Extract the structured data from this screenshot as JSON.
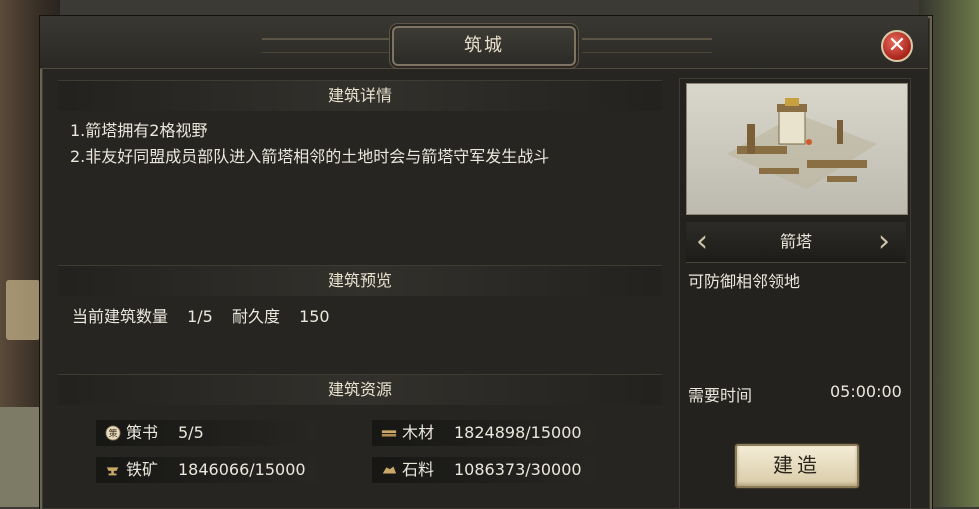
{
  "title": "筑城",
  "details": {
    "header": "建筑详情",
    "lines": [
      "1.箭塔拥有2格视野",
      "2.非友好同盟成员部队进入箭塔相邻的土地时会与箭塔守军发生战斗"
    ]
  },
  "preview": {
    "header": "建筑预览",
    "count_label": "当前建筑数量",
    "count_value": "1/5",
    "durability_label": "耐久度",
    "durability_value": "150"
  },
  "resources": {
    "header": "建筑资源",
    "items": [
      {
        "icon": "strategy-book-icon",
        "icon_text": "策",
        "label": "策书",
        "value": "5/5"
      },
      {
        "icon": "wood-icon",
        "label": "木材",
        "value": "1824898/15000"
      },
      {
        "icon": "iron-anvil-icon",
        "label": "铁矿",
        "value": "1846066/15000"
      },
      {
        "icon": "stone-icon",
        "label": "石料",
        "value": "1086373/30000"
      }
    ]
  },
  "building": {
    "name": "箭塔",
    "description": "可防御相邻领地",
    "time_label": "需要时间",
    "time_value": "05:00:00",
    "build_label": "建造"
  },
  "colors": {
    "close": "#c0392b",
    "text": "#ebe7dc",
    "panel": "#262522"
  }
}
